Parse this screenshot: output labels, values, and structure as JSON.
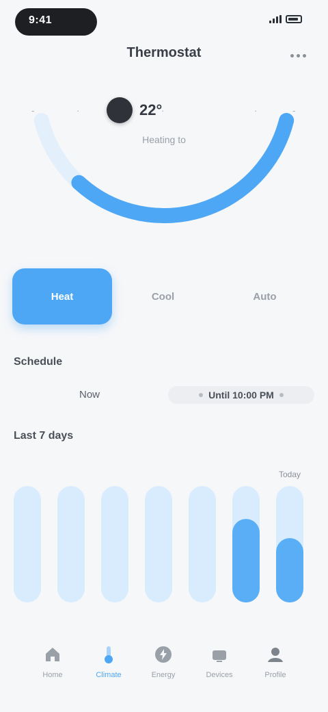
{
  "status_bar": {
    "time": "9:41"
  },
  "header": {
    "title": "Thermostat"
  },
  "dial": {
    "markers": [
      "-",
      "·",
      "·",
      "·",
      "-"
    ],
    "value": "22°",
    "subtitle": "Heating to",
    "level": 0.62,
    "accent": "#4da7f5",
    "track": "#e3f0fc"
  },
  "modes": {
    "items": [
      {
        "label": "Heat"
      },
      {
        "label": "Cool"
      },
      {
        "label": "Auto"
      }
    ],
    "active_index": 0
  },
  "schedule": {
    "label": "Schedule",
    "left_value": "Now",
    "right_value": "Until 10:00 PM"
  },
  "history": {
    "label": "Last 7 days",
    "top_label": "Today",
    "levels": [
      0.0,
      0.0,
      0.0,
      0.0,
      0.0,
      0.72,
      0.55
    ],
    "highlight_color": "#5aaef6",
    "track_color": "#d9ecfd"
  },
  "tabbar": {
    "items": [
      {
        "label": "Home",
        "icon": "home-icon"
      },
      {
        "label": "Climate",
        "icon": "thermometer-icon"
      },
      {
        "label": "Energy",
        "icon": "bolt-icon"
      },
      {
        "label": "Devices",
        "icon": "devices-icon"
      },
      {
        "label": "Profile",
        "icon": "user-icon"
      }
    ],
    "active_index": 1
  }
}
